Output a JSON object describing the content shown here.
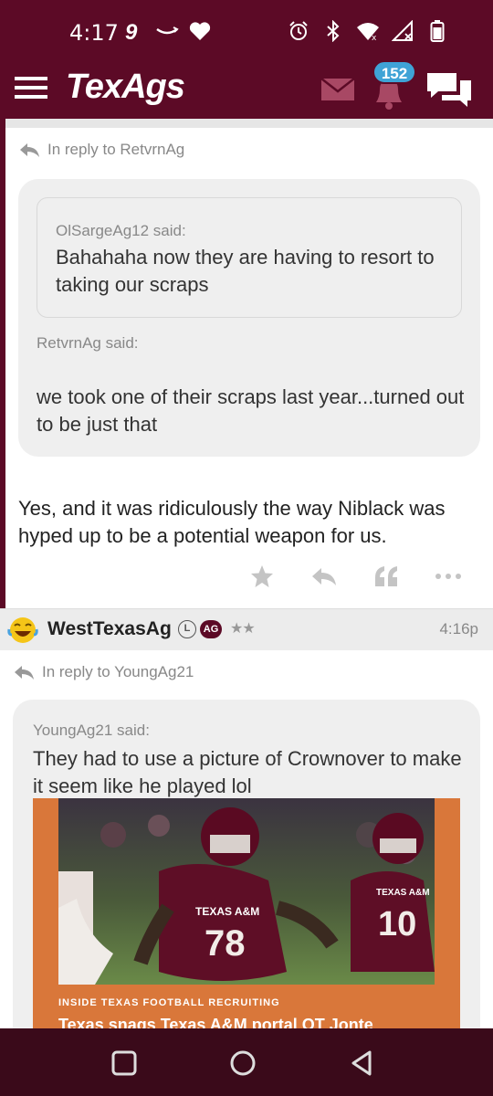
{
  "status_bar": {
    "time": "4:17",
    "left_icons": [
      "nine-icon",
      "amazon-smile-icon",
      "heart-icon"
    ],
    "right_icons": [
      "alarm-icon",
      "bluetooth-icon",
      "wifi-icon",
      "signal-icon",
      "battery-icon"
    ]
  },
  "header": {
    "logo": "TexAgs",
    "notification_count": "152",
    "icons": [
      "menu-icon",
      "mail-icon",
      "bell-icon",
      "chat-icon"
    ]
  },
  "post1": {
    "reply_to": "In reply to RetvrnAg",
    "nested_quote_author": "OlSargeAg12 said:",
    "nested_quote_text": "Bahahaha now they are having to resort to taking our scraps",
    "quote_author": "RetvrnAg said:",
    "quote_text": "we took one of their scraps last year...turned out to be just that",
    "body": "Yes, and it was ridiculously the way Niblack was hyped up to be a potential weapon for us.",
    "actions": [
      "star-icon",
      "reply-icon",
      "quote-icon",
      "more-icon"
    ]
  },
  "post2": {
    "username": "WestTexasAg",
    "badge_l": "L",
    "badge_ag": "AG",
    "stars": "★★",
    "time": "4:16p",
    "reply_to": "In reply to YoungAg21",
    "quote_author": "YoungAg21 said:",
    "quote_text": "They had to use a picture of Crownover to make it seem like he played lol",
    "embed": {
      "kicker": "INSIDE TEXAS FOOTBALL RECRUITING",
      "headline": "Texas snags Texas A&M portal OT Jonte",
      "jersey_text_1": "TEXAS A&M",
      "jersey_number_1": "78",
      "jersey_text_2": "TEXAS A&M",
      "jersey_number_2": "10"
    }
  },
  "nav_bar": {
    "buttons": [
      "recents-icon",
      "home-icon",
      "back-icon"
    ]
  },
  "colors": {
    "maroon": "#5c0a26",
    "badge_blue": "#3fa3d6",
    "embed_orange": "#d9773a"
  }
}
